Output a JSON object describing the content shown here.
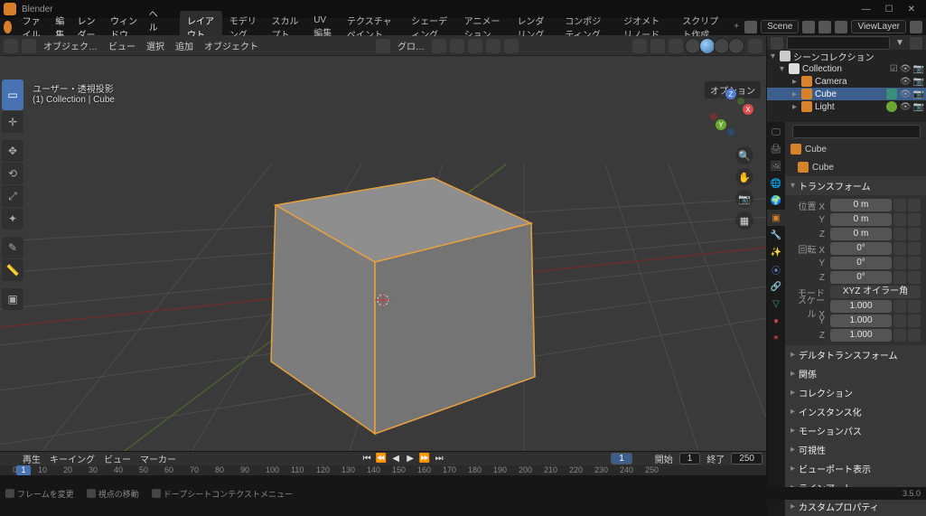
{
  "app": {
    "title": "Blender"
  },
  "window": {
    "min": "—",
    "max": "☐",
    "close": "✕"
  },
  "menu": {
    "file": "ファイル",
    "edit": "編集",
    "render": "レンダー",
    "window": "ウィンドウ",
    "help": "ヘルプ"
  },
  "workspaces": {
    "layout": "レイアウト",
    "modeling": "モデリング",
    "sculpt": "スカルプト",
    "uv": "UV編集",
    "texpaint": "テクスチャペイント",
    "shading": "シェーディング",
    "animation": "アニメーション",
    "rendering": "レンダリング",
    "compositing": "コンポジティング",
    "geonodes": "ジオメトリノード",
    "scripting": "スクリプト作成",
    "plus": "+"
  },
  "scene": {
    "icon_label": "Scene",
    "viewlayer": "ViewLayer"
  },
  "vp_header": {
    "mode_label": "オブジェク…",
    "view": "ビュー",
    "select": "選択",
    "add": "追加",
    "object": "オブジェクト",
    "global": "グロ…"
  },
  "vp": {
    "options_label": "オプション",
    "view_label_1": "ユーザー・透視投影",
    "view_label_2": "(1) Collection | Cube"
  },
  "gizmo": {
    "x": "X",
    "y": "Y",
    "z": "Z"
  },
  "outliner": {
    "scene_collection": "シーンコレクション",
    "collection": "Collection",
    "camera": "Camera",
    "cube": "Cube",
    "light": "Light"
  },
  "props": {
    "search_placeholder": "",
    "crumb_cube": "Cube",
    "crumb_cube2": "Cube",
    "panel_transform": "トランスフォーム",
    "loc_x": "位置 X",
    "y": "Y",
    "z": "Z",
    "rot_x": "回転 X",
    "mode": "モード",
    "mode_val": "XYZ オイラー角",
    "scale_x": "スケール X",
    "loc_val": "0 m",
    "rot_val": "0°",
    "scale_val": "1.000",
    "panel_delta": "デルタトランスフォーム",
    "panel_relations": "関係",
    "panel_collections": "コレクション",
    "panel_instancing": "インスタンス化",
    "panel_motionpath": "モーションパス",
    "panel_visibility": "可視性",
    "panel_viewport": "ビューポート表示",
    "panel_lineart": "ラインアート",
    "panel_custom": "カスタムプロパティ"
  },
  "timeline": {
    "playback": "再生",
    "keying": "キーイング",
    "view": "ビュー",
    "marker": "マーカー",
    "frame_current": "1",
    "start_lbl": "開始",
    "start": "1",
    "end_lbl": "終了",
    "end": "250",
    "ticks": [
      "0",
      "10",
      "20",
      "30",
      "40",
      "50",
      "60",
      "70",
      "80",
      "90",
      "100",
      "110",
      "120",
      "130",
      "140",
      "150",
      "160",
      "170",
      "180",
      "190",
      "200",
      "210",
      "220",
      "230",
      "240",
      "250"
    ]
  },
  "status": {
    "s1": "フレームを変更",
    "s2": "視点の移動",
    "s3": "ドープシートコンテクストメニュー",
    "version": "3.5.0"
  }
}
